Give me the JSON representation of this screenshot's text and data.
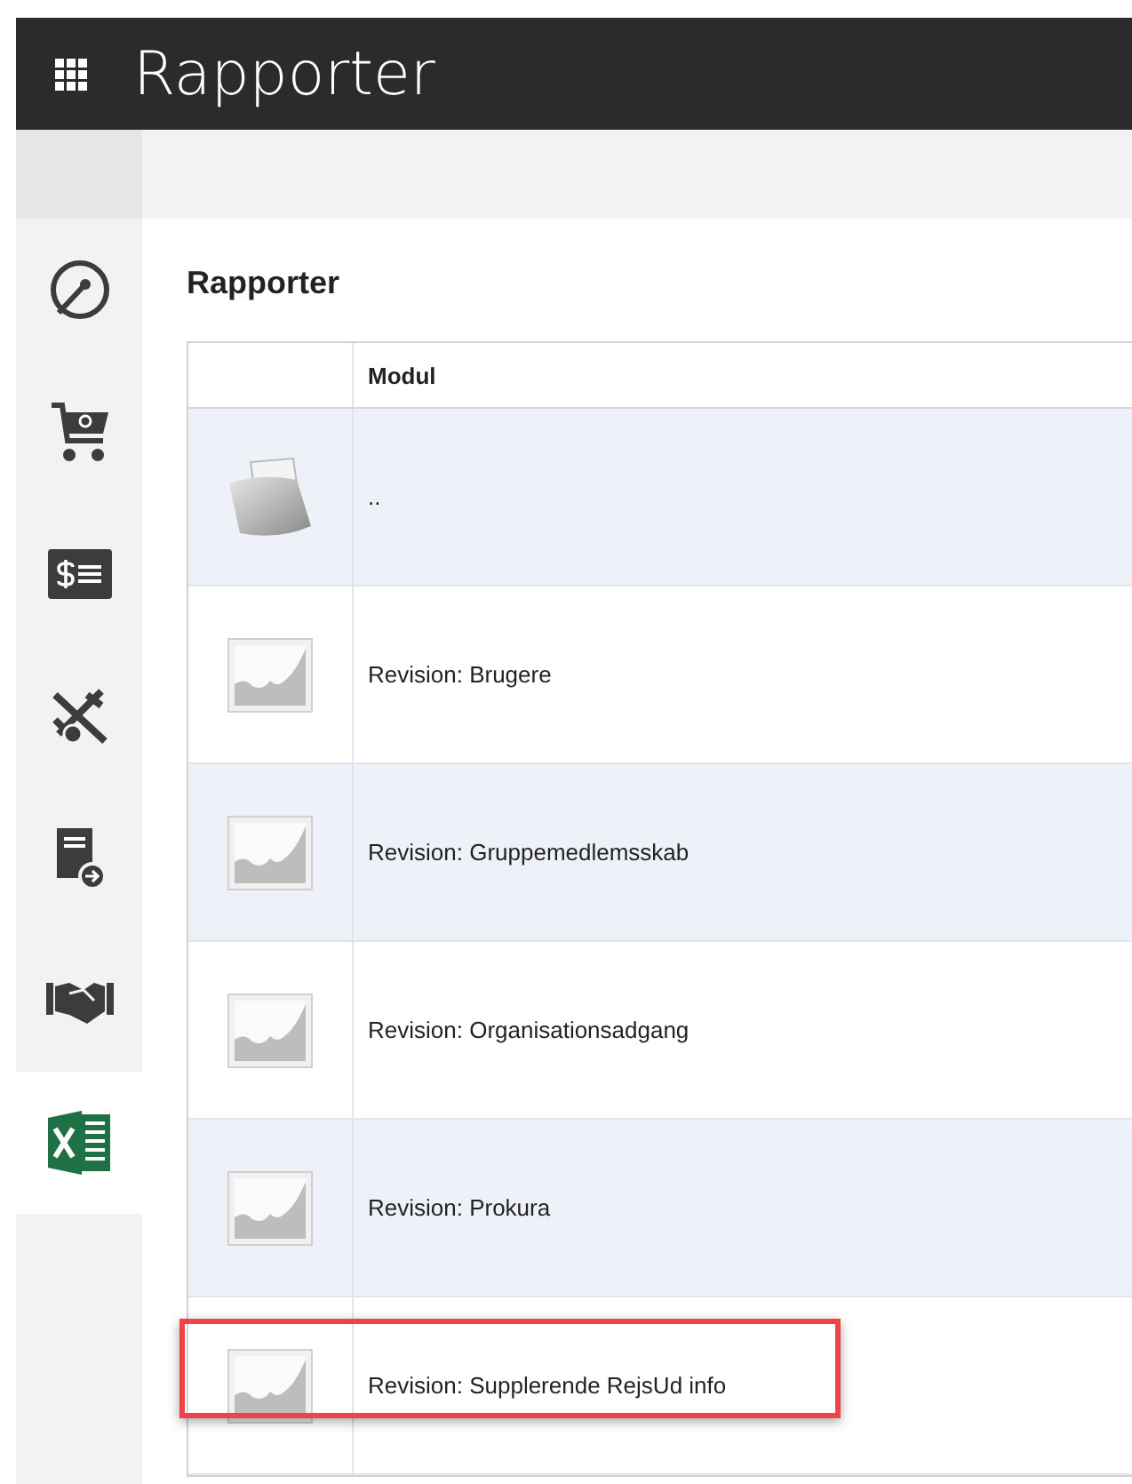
{
  "header": {
    "title": "Rapporter"
  },
  "sidebar": {
    "items": [
      {
        "kind": "gauge",
        "selected": false
      },
      {
        "kind": "cart",
        "selected": false
      },
      {
        "kind": "invoice",
        "selected": false
      },
      {
        "kind": "travel",
        "selected": false
      },
      {
        "kind": "document",
        "selected": false
      },
      {
        "kind": "handshake",
        "selected": false
      },
      {
        "kind": "excel",
        "selected": true
      }
    ]
  },
  "page": {
    "heading": "Rapporter"
  },
  "table": {
    "columns": [
      "Modul"
    ],
    "rows": [
      {
        "kind": "folder",
        "name": "..",
        "highlighted": false
      },
      {
        "kind": "report",
        "name": "Revision: Brugere",
        "highlighted": false
      },
      {
        "kind": "report",
        "name": "Revision: Gruppemedlemsskab",
        "highlighted": false
      },
      {
        "kind": "report",
        "name": "Revision: Organisationsadgang",
        "highlighted": false
      },
      {
        "kind": "report",
        "name": "Revision: Prokura",
        "highlighted": false
      },
      {
        "kind": "report",
        "name": "Revision: Supplerende RejsUd info",
        "highlighted": true
      }
    ]
  }
}
